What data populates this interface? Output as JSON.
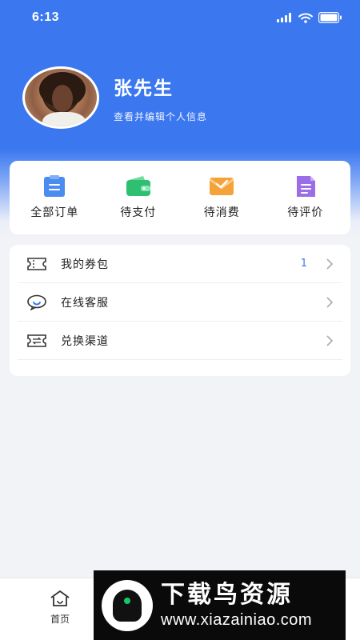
{
  "status_bar": {
    "time": "6:13"
  },
  "profile": {
    "name": "张先生",
    "subtitle": "查看并编辑个人信息"
  },
  "orders": [
    {
      "label": "全部订单",
      "icon": "clipboard-icon",
      "color": "#4a8cf0"
    },
    {
      "label": "待支付",
      "icon": "wallet-icon",
      "color": "#2fbf71"
    },
    {
      "label": "待消费",
      "icon": "envelope-icon",
      "color": "#f4a23a"
    },
    {
      "label": "待评价",
      "icon": "document-icon",
      "color": "#9b6ee8"
    }
  ],
  "menu": [
    {
      "label": "我的券包",
      "icon": "ticket-icon",
      "count": "1"
    },
    {
      "label": "在线客服",
      "icon": "chat-bubble-icon",
      "count": ""
    },
    {
      "label": "兑换渠道",
      "icon": "exchange-ticket-icon",
      "count": ""
    }
  ],
  "tabbar": {
    "home_label": "首页",
    "home_icon": "home-icon"
  },
  "watermark": {
    "title": "下载鸟资源",
    "url": "www.xiazainiao.com"
  },
  "colors": {
    "primary": "#3b78f0",
    "background": "#f2f3f6"
  }
}
